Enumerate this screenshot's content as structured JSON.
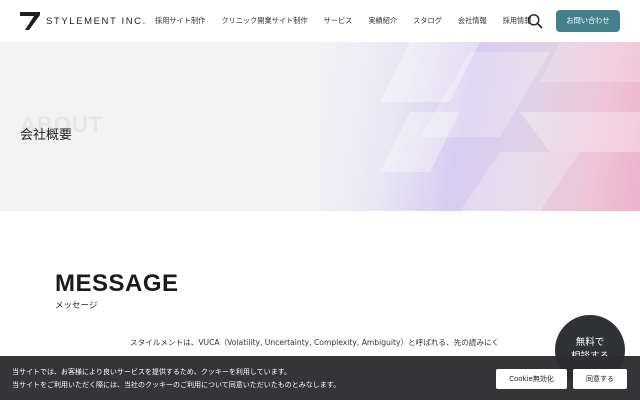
{
  "header": {
    "logo_text": "STYLEMENT INC.",
    "nav": [
      "採用サイト制作",
      "クリニック開業サイト制作",
      "サービス",
      "実績紹介",
      "スタログ",
      "会社情報",
      "採用情報"
    ],
    "search_icon": "search-icon",
    "contact_label": "お問い合わせ"
  },
  "hero": {
    "bg_text": "ABOUT",
    "title": "会社概要"
  },
  "message": {
    "title": "MESSAGE",
    "subtitle": "メッセージ",
    "body_line1": "スタイルメントは、VUCA（Volatility, Uncertainty, Complexity, Ambiguity）と呼ばれる、先の読みにく"
  },
  "consult": {
    "line1": "無料で",
    "line2": "相談する"
  },
  "cookie": {
    "line1": "当サイトでは、お客様により良いサービスを提供するため、クッキーを利用しています。",
    "line2": "当サイトをご利用いただく際には、当社のクッキーのご利用について同意いただいたものとみなします。",
    "disable_label": "Cookie無効化",
    "accept_label": "同意する"
  },
  "colors": {
    "accent": "#43808c",
    "cookie_bg": "#2d2d30",
    "consult_bg": "#2f3134"
  }
}
